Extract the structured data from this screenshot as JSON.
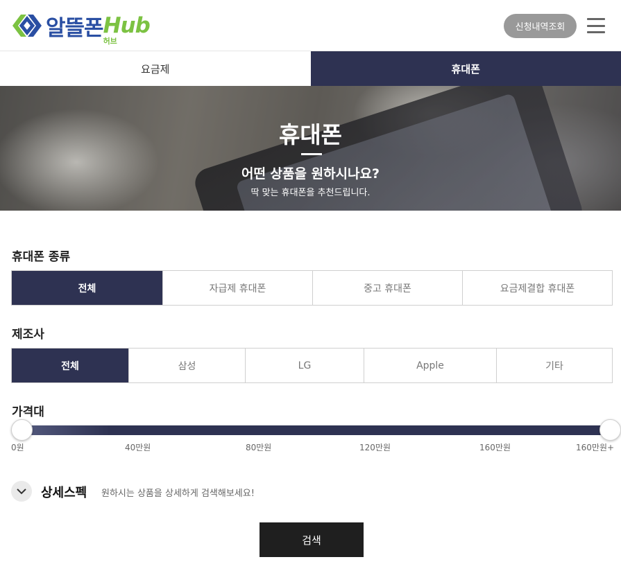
{
  "header": {
    "logo_text": "알뜰폰",
    "logo_hub": "Hub",
    "logo_sub": "허브",
    "apply_button": "신청내역조회",
    "menu_icon": "hamburger-menu-icon"
  },
  "tabs": [
    {
      "label": "요금제",
      "active": false
    },
    {
      "label": "휴대폰",
      "active": true
    }
  ],
  "banner": {
    "title": "휴대폰",
    "subtitle": "어떤 상품을 원하시나요?",
    "description": "딱 맞는 휴대폰을 추천드립니다."
  },
  "phone_type": {
    "label": "휴대폰 종류",
    "options": [
      "전체",
      "자급제 휴대폰",
      "중고 휴대폰",
      "요금제결합 휴대폰"
    ],
    "selected": "전체"
  },
  "manufacturer": {
    "label": "제조사",
    "options": [
      "전체",
      "삼성",
      "LG",
      "Apple",
      "기타"
    ],
    "selected": "전체"
  },
  "price_range": {
    "label": "가격대",
    "ticks": [
      "0원",
      "40만원",
      "80만원",
      "120만원",
      "160만원",
      "160만원+"
    ],
    "selected_min": "0원",
    "selected_max": "160만원+"
  },
  "detail_spec": {
    "title": "상세스펙",
    "description": "원하시는 상품을 상세하게 검색해보세요!",
    "toggle_icon": "chevron-down-icon"
  },
  "search_button": "검색",
  "colors": {
    "accent": "#2e3252",
    "logo_blue": "#2a4fa3",
    "logo_green": "#7cc242",
    "button_gray": "#999999",
    "search_button": "#1f1f1f"
  }
}
